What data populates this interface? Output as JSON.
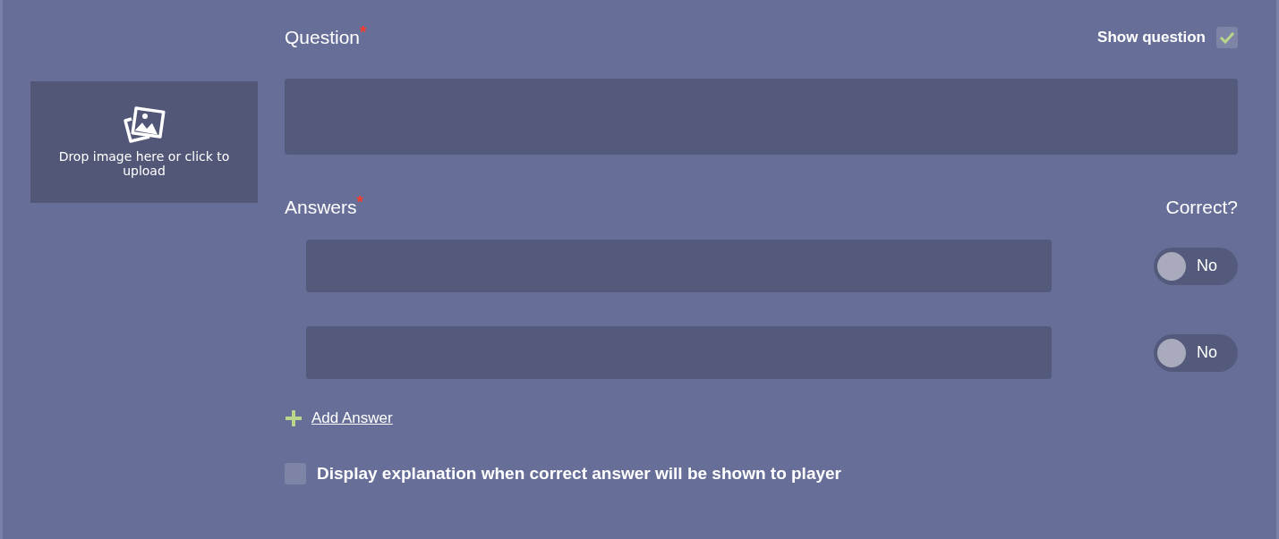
{
  "image_drop": {
    "text": "Drop image here or click to upload"
  },
  "question": {
    "label": "Question$^{*}$"
  },
  "show_question": {
    "label": "Show question",
    "checked": true
  },
  "answers_label": "Answers$^{*}$",
  "correct_label": "Correct?",
  "answers": [
    {
      "correct": {
        "on": false,
        "label": "No"
      }
    },
    {
      "correct": {
        "on": false,
        "label": "No"
      }
    }
  ],
  "add_answer": {
    "label": "Add Answer"
  },
  "explanation": {
    "label": "Display explanation when correct answer will be shown to player",
    "checked": false
  }
}
